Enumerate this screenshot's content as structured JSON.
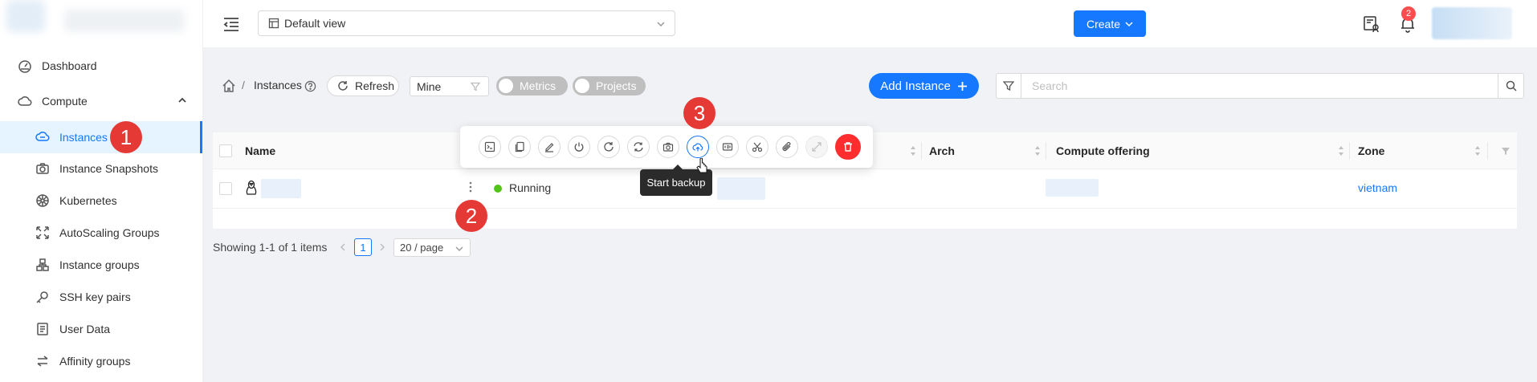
{
  "sidebar": {
    "items": [
      {
        "label": "Dashboard",
        "icon": "dashboard-icon"
      },
      {
        "label": "Compute",
        "icon": "cloud-icon"
      },
      {
        "label": "Instances",
        "icon": "cloud-server-icon"
      },
      {
        "label": "Instance Snapshots",
        "icon": "camera-icon"
      },
      {
        "label": "Kubernetes",
        "icon": "kubernetes-icon"
      },
      {
        "label": "AutoScaling Groups",
        "icon": "autoscale-icon"
      },
      {
        "label": "Instance groups",
        "icon": "groups-icon"
      },
      {
        "label": "SSH key pairs",
        "icon": "key-icon"
      },
      {
        "label": "User Data",
        "icon": "document-icon"
      },
      {
        "label": "Affinity groups",
        "icon": "swap-icon"
      }
    ]
  },
  "header": {
    "view_select": "Default view",
    "create_label": "Create",
    "notification_count": "2"
  },
  "toolbar": {
    "breadcrumb_current": "Instances",
    "breadcrumb_separator": "/",
    "refresh_label": "Refresh",
    "filter_select": "Mine",
    "metrics_toggle": "Metrics",
    "projects_toggle": "Projects",
    "add_instance_label": "Add Instance",
    "search_placeholder": "Search"
  },
  "table": {
    "columns": [
      "Name",
      "Arch",
      "Compute offering",
      "Zone"
    ],
    "rows": [
      {
        "name": "",
        "state": "Running",
        "arch": "",
        "compute_offering": "",
        "zone": "vietnam"
      }
    ]
  },
  "pagination": {
    "summary": "Showing 1-1 of 1 items",
    "current_page": "1",
    "page_size": "20 / page"
  },
  "action_bar": {
    "actions": [
      "console",
      "copy",
      "edit",
      "stop",
      "reboot",
      "reinstall",
      "snapshot",
      "start-backup",
      "iso",
      "cut",
      "attach",
      "expand",
      "destroy"
    ],
    "tooltip": "Start backup"
  },
  "steps": [
    "1",
    "2",
    "3"
  ],
  "colors": {
    "primary": "#1677ff",
    "danger": "#ff2d2d",
    "running": "#52c41a",
    "step_marker": "#e53935"
  }
}
